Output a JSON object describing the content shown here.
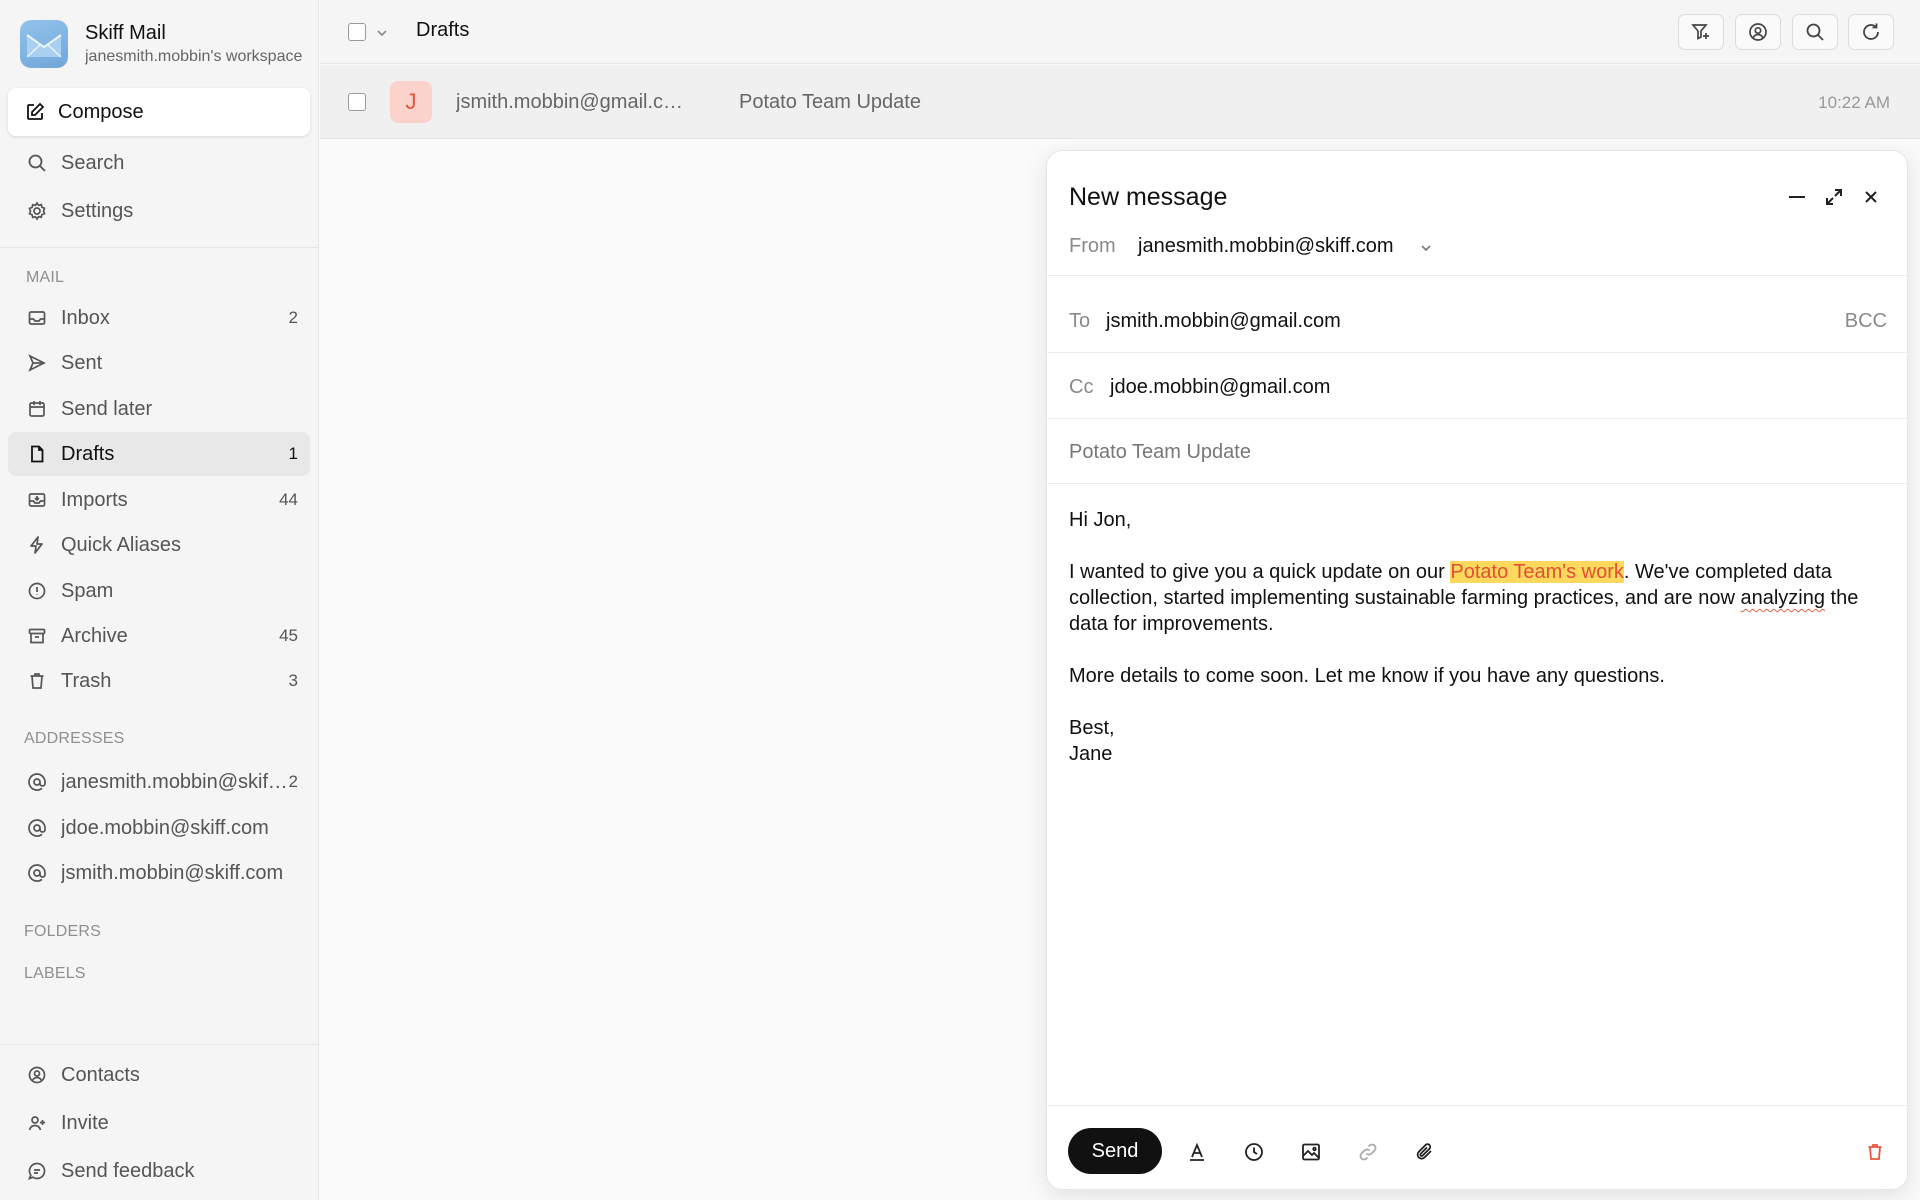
{
  "app": {
    "name": "Skiff Mail",
    "account": "janesmith.mobbin's workspace"
  },
  "sidebar": {
    "compose_label": "Compose",
    "search_label": "Search",
    "settings_label": "Settings",
    "mail_section": "MAIL",
    "mail_items": [
      {
        "label": "Inbox",
        "count": "2",
        "icon": "inbox-icon"
      },
      {
        "label": "Sent",
        "count": "",
        "icon": "send-icon"
      },
      {
        "label": "Send later",
        "count": "",
        "icon": "calendar-icon"
      },
      {
        "label": "Drafts",
        "count": "1",
        "icon": "draft-icon",
        "active": true
      },
      {
        "label": "Imports",
        "count": "44",
        "icon": "import-icon"
      },
      {
        "label": "Quick Aliases",
        "count": "",
        "icon": "bolt-icon"
      },
      {
        "label": "Spam",
        "count": "",
        "icon": "spam-icon"
      },
      {
        "label": "Archive",
        "count": "45",
        "icon": "archive-icon"
      },
      {
        "label": "Trash",
        "count": "3",
        "icon": "trash-icon"
      }
    ],
    "addresses_section": "ADDRESSES",
    "addresses": [
      {
        "label": "janesmith.mobbin@skiff.com",
        "count": "2"
      },
      {
        "label": "jdoe.mobbin@skiff.com",
        "count": ""
      },
      {
        "label": "jsmith.mobbin@skiff.com",
        "count": ""
      }
    ],
    "folders_section": "FOLDERS",
    "labels_section": "LABELS",
    "bottom_items": [
      {
        "label": "Contacts",
        "icon": "contacts-icon"
      },
      {
        "label": "Invite",
        "icon": "invite-icon"
      },
      {
        "label": "Send feedback",
        "icon": "feedback-icon"
      }
    ]
  },
  "list": {
    "title": "Drafts",
    "rows": [
      {
        "avatar": "J",
        "from": "jsmith.mobbin@gmail.com",
        "subject": "Potato Team Update",
        "time": "10:22 AM"
      }
    ]
  },
  "compose": {
    "title": "New message",
    "from_label": "From",
    "from_value": "janesmith.mobbin@skiff.com",
    "to_label": "To",
    "to_value": "jsmith.mobbin@gmail.com",
    "bcc_label": "BCC",
    "cc_label": "Cc",
    "cc_value": "jdoe.mobbin@gmail.com",
    "subject": "Potato Team Update",
    "body": {
      "greeting": "Hi Jon,",
      "p1_before": "I wanted to give you a quick update on our ",
      "p1_highlight": "Potato Team's work",
      "p1_mid": ". We've completed data collection, started implementing sustainable farming practices, and are now ",
      "p1_misspelled": "analyzing",
      "p1_after": " the data for improvements.",
      "p2": "More details to come soon. Let me know if you have any questions.",
      "signoff": "Best,",
      "name": "Jane"
    },
    "send_label": "Send"
  },
  "colors": {
    "highlight_bg": "#fcd95d",
    "highlight_text": "#e34f35",
    "trash_red": "#e4573d",
    "avatar_bg": "#fbd3cc"
  }
}
